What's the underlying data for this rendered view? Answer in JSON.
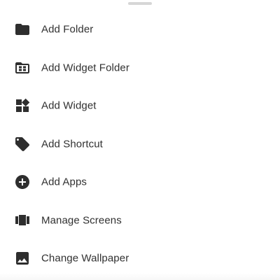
{
  "menu": {
    "items": [
      {
        "label": "Add Folder",
        "icon": "folder-icon"
      },
      {
        "label": "Add Widget Folder",
        "icon": "widget-folder-icon"
      },
      {
        "label": "Add Widget",
        "icon": "widgets-icon"
      },
      {
        "label": "Add Shortcut",
        "icon": "tag-icon"
      },
      {
        "label": "Add Apps",
        "icon": "add-circle-icon"
      },
      {
        "label": "Manage Screens",
        "icon": "screens-carousel-icon"
      },
      {
        "label": "Change Wallpaper",
        "icon": "image-icon"
      }
    ]
  },
  "colors": {
    "icon": "#2e2e2e",
    "text": "#303030",
    "handle": "#d6d6d6",
    "background": "#ffffff"
  }
}
